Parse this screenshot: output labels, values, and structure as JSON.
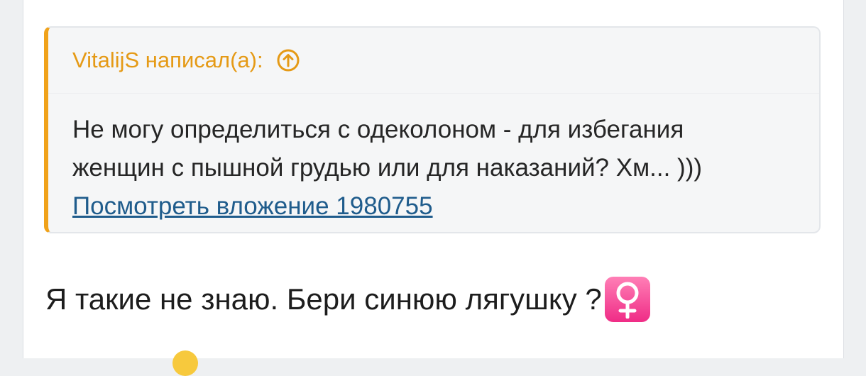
{
  "quote": {
    "author_header": "VitalijS написал(а):",
    "text": "Не могу определиться с одеколоном - для избегания женщин с пышной грудью или для наказаний? Хм... )))",
    "attachment_link": "Посмотреть вложение 1980755",
    "accent_color": "#f0a21a",
    "icon": "arrow-up-circle-icon"
  },
  "reply": {
    "text": "Я такие не знаю. Бери синюю лягушку ?",
    "emoji": "female-sign-emoji"
  },
  "next_line_emoji": "smiley-emoji"
}
